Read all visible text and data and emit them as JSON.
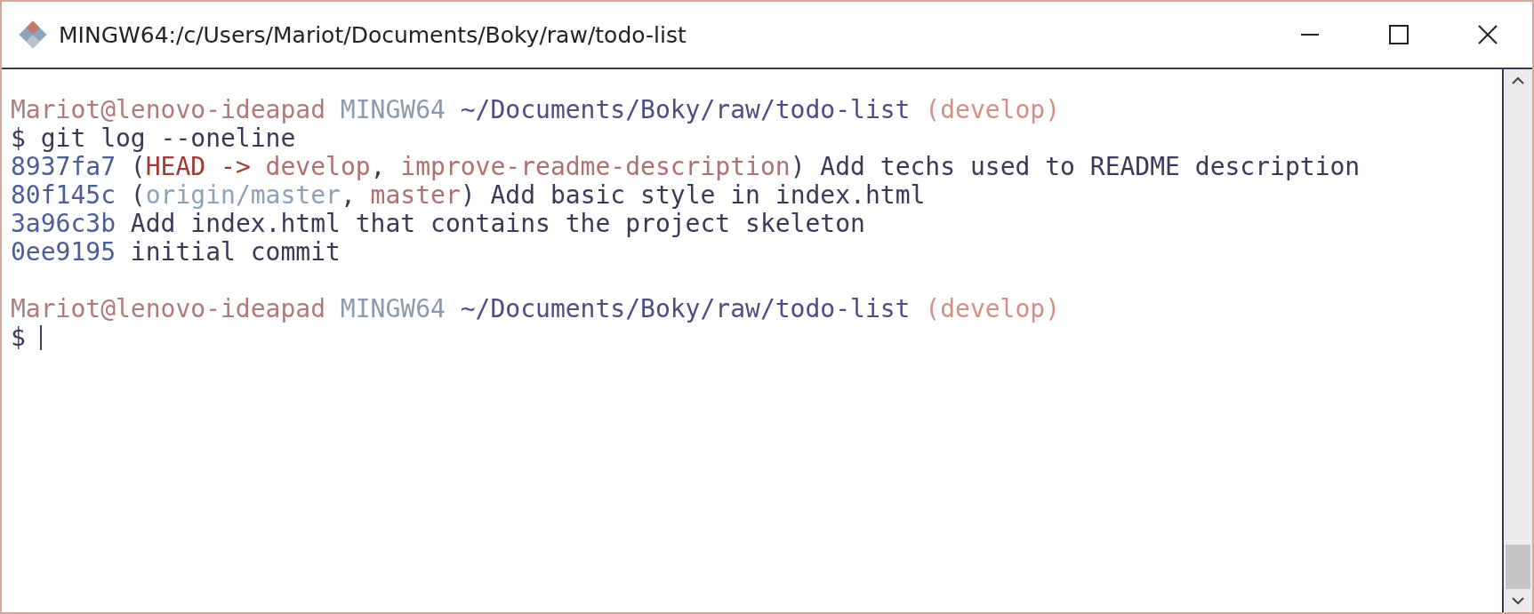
{
  "window": {
    "title": "MINGW64:/c/Users/Mariot/Documents/Boky/raw/todo-list"
  },
  "terminal": {
    "lines": [
      {
        "kind": "text",
        "segments": [
          {
            "text": "Mariot@lenovo-ideapad",
            "kind": "user"
          },
          {
            "text": " MINGW64",
            "kind": "host"
          },
          {
            "text": " ~/Documents/Boky/raw/todo-list",
            "kind": "path"
          },
          {
            "text": " (develop)",
            "kind": "branch"
          }
        ]
      },
      {
        "kind": "text",
        "segments": [
          {
            "text": "$ git log --oneline",
            "kind": "plain"
          }
        ]
      },
      {
        "kind": "text",
        "segments": [
          {
            "text": "8937fa7",
            "kind": "hash"
          },
          {
            "text": " (",
            "kind": "plain"
          },
          {
            "text": "HEAD ->",
            "kind": "head"
          },
          {
            "text": " develop",
            "kind": "local"
          },
          {
            "text": ", ",
            "kind": "plain"
          },
          {
            "text": "improve-readme-description",
            "kind": "local"
          },
          {
            "text": ") Add techs used to README description",
            "kind": "plain"
          }
        ]
      },
      {
        "kind": "text",
        "segments": [
          {
            "text": "80f145c",
            "kind": "hash"
          },
          {
            "text": " (",
            "kind": "plain"
          },
          {
            "text": "origin/master",
            "kind": "remote"
          },
          {
            "text": ", ",
            "kind": "plain"
          },
          {
            "text": "master",
            "kind": "local"
          },
          {
            "text": ") Add basic style in index.html",
            "kind": "plain"
          }
        ]
      },
      {
        "kind": "text",
        "segments": [
          {
            "text": "3a96c3b",
            "kind": "hash"
          },
          {
            "text": " Add index.html that contains the project skeleton",
            "kind": "plain"
          }
        ]
      },
      {
        "kind": "text",
        "segments": [
          {
            "text": "0ee9195",
            "kind": "hash"
          },
          {
            "text": " initial commit",
            "kind": "plain"
          }
        ]
      },
      {
        "kind": "blank"
      },
      {
        "kind": "text",
        "segments": [
          {
            "text": "Mariot@lenovo-ideapad",
            "kind": "user"
          },
          {
            "text": " MINGW64",
            "kind": "host"
          },
          {
            "text": " ~/Documents/Boky/raw/todo-list",
            "kind": "path"
          },
          {
            "text": " (develop)",
            "kind": "branch"
          }
        ]
      },
      {
        "kind": "input",
        "segments": [
          {
            "text": "$",
            "kind": "plain"
          }
        ]
      }
    ]
  }
}
